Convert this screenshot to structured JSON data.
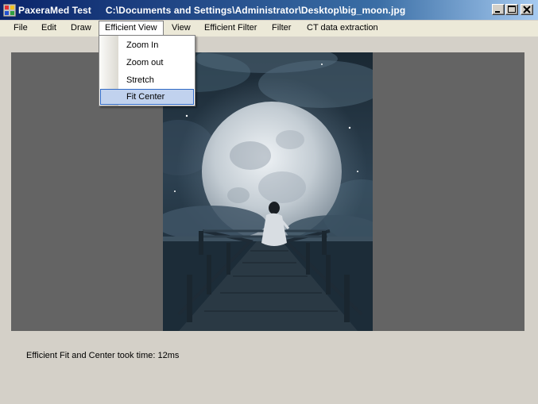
{
  "window": {
    "app_title": "PaxeraMed Test",
    "file_path": "C:\\Documents and Settings\\Administrator\\Desktop\\big_moon.jpg",
    "icon": "app-grid-icon",
    "controls": [
      "minimize-icon",
      "maximize-icon",
      "close-icon"
    ]
  },
  "menu": {
    "items": [
      "File",
      "Edit",
      "Draw",
      "Efficient View",
      "View",
      "Efficient Filter",
      "Filter",
      "CT data extraction"
    ],
    "open_index": 3
  },
  "dropdown": {
    "items": [
      "Zoom In",
      "Zoom out",
      "Stretch",
      "Fit Center"
    ],
    "highlighted_index": 3
  },
  "status": {
    "message": "Efficient Fit and Center took time: 12ms"
  },
  "colors": {
    "title_gradient_start": "#0a246a",
    "title_gradient_end": "#a6caf0",
    "menubar": "#ece9d8",
    "viewer_background": "#646464",
    "window_background": "#d4d0c8",
    "menu_highlight": "#c1d2ee",
    "menu_highlight_border": "#316ac5"
  }
}
